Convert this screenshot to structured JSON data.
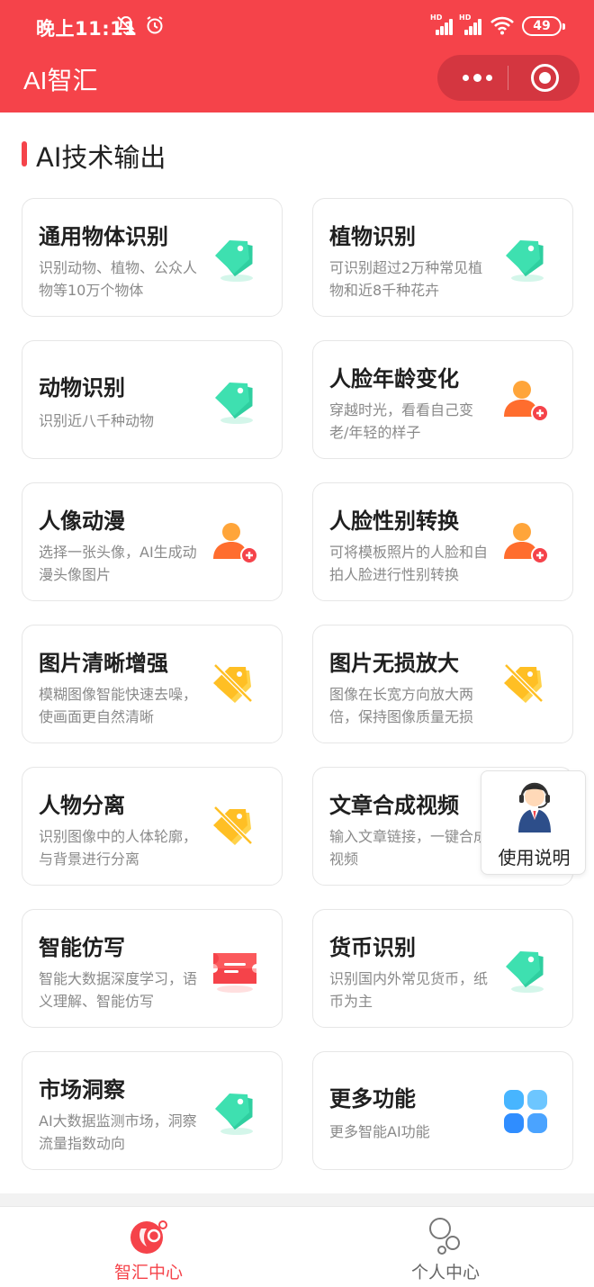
{
  "status_bar": {
    "time": "晚上11:11",
    "signal_hd_1": "HD",
    "signal_hd_2": "HD",
    "battery": "49"
  },
  "nav": {
    "title": "AI智汇",
    "more_icon": "more-dots-icon",
    "close_icon": "target-circle-icon"
  },
  "section": {
    "title": "AI技术输出",
    "accent": "#f5434a"
  },
  "cards": [
    {
      "title": "通用物体识别",
      "desc": "识别动物、植物、公众人物等10万个物体",
      "icon": "tag-green-icon"
    },
    {
      "title": "植物识别",
      "desc": "可识别超过2万种常见植物和近8千种花卉",
      "icon": "tag-green-icon"
    },
    {
      "title": "动物识别",
      "desc": "识别近八千种动物",
      "icon": "tag-green-icon"
    },
    {
      "title": "人脸年龄变化",
      "desc": "穿越时光，看看自己变老/年轻的样子",
      "icon": "person-add-icon"
    },
    {
      "title": "人像动漫",
      "desc": "选择一张头像，AI生成动漫头像图片",
      "icon": "person-add-icon"
    },
    {
      "title": "人脸性别转换",
      "desc": "可将模板照片的人脸和自拍人脸进行性别转换",
      "icon": "person-add-icon"
    },
    {
      "title": "图片清晰增强",
      "desc": "模糊图像智能快速去噪，使画面更自然清晰",
      "icon": "tag-off-yellow-icon"
    },
    {
      "title": "图片无损放大",
      "desc": "图像在长宽方向放大两倍，保持图像质量无损",
      "icon": "tag-off-yellow-icon"
    },
    {
      "title": "人物分离",
      "desc": "识别图像中的人体轮廓，与背景进行分离",
      "icon": "tag-off-yellow-icon"
    },
    {
      "title": "文章合成视频",
      "desc": "输入文章链接，一键合成视频",
      "icon": "video-icon"
    },
    {
      "title": "智能仿写",
      "desc": "智能大数据深度学习，语义理解、智能仿写",
      "icon": "ticket-red-icon"
    },
    {
      "title": "货币识别",
      "desc": "识别国内外常见货币，纸币为主",
      "icon": "tag-green-icon"
    },
    {
      "title": "市场洞察",
      "desc": "AI大数据监测市场，洞察流量指数动向",
      "icon": "tag-green-icon"
    },
    {
      "title": "更多功能",
      "desc": "更多智能AI功能",
      "icon": "grid-blue-icon"
    }
  ],
  "help": {
    "label": "使用说明",
    "icon": "customer-service-icon"
  },
  "tabbar": {
    "tabs": [
      {
        "label": "智汇中心",
        "active": true,
        "icon": "home-brain-icon"
      },
      {
        "label": "个人中心",
        "active": false,
        "icon": "bubbles-icon"
      }
    ],
    "active_color": "#f5434a",
    "inactive_color": "#666666"
  }
}
